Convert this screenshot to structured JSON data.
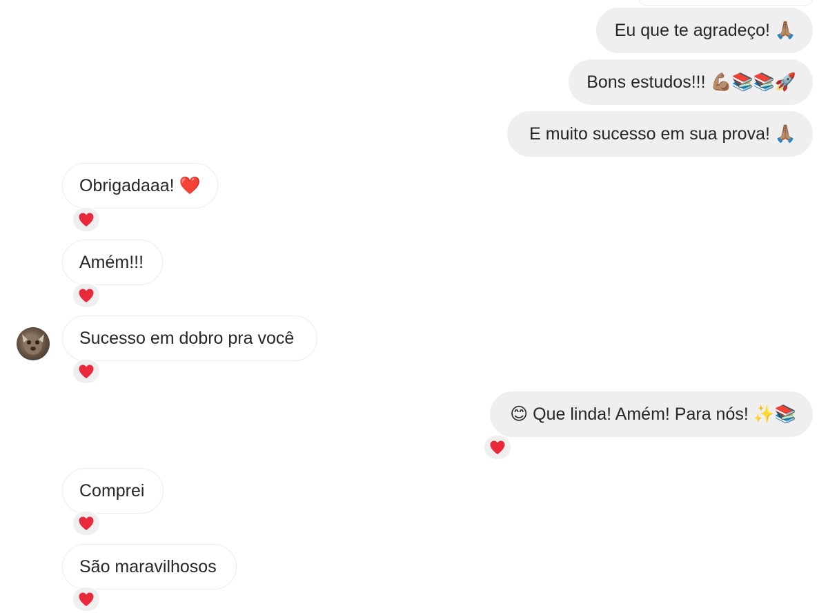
{
  "conversation": {
    "messages": [
      {
        "id": "m1",
        "direction": "sent",
        "text": "Eu que te agradeço! 🙏🏽"
      },
      {
        "id": "m2",
        "direction": "sent",
        "text": "Bons estudos!!! 💪🏽📚📚🚀"
      },
      {
        "id": "m3",
        "direction": "sent",
        "text": "E muito sucesso em sua prova! 🙏🏽"
      },
      {
        "id": "m4",
        "direction": "received",
        "text": "Obrigadaaa! ❤️",
        "reaction": "❤️"
      },
      {
        "id": "m5",
        "direction": "received",
        "text": "Amém!!!",
        "reaction": "❤️"
      },
      {
        "id": "m6",
        "direction": "received",
        "text": "Sucesso em dobro pra você",
        "reaction": "❤️",
        "avatar": "contact-avatar"
      },
      {
        "id": "m7",
        "direction": "sent",
        "text": "😊 Que linda! Amém! Para nós! ✨📚",
        "reaction": "❤️"
      },
      {
        "id": "m8",
        "direction": "received",
        "text": "Comprei",
        "reaction": "❤️"
      },
      {
        "id": "m9",
        "direction": "received",
        "text": "São maravilhosos",
        "reaction": "❤️"
      }
    ]
  },
  "colors": {
    "sent_bubble": "#efefef",
    "received_bubble": "#ffffff",
    "heart": "#e8283b",
    "text": "#262626"
  },
  "icons": {
    "reaction": "heart-icon",
    "avatar": "contact-avatar"
  }
}
